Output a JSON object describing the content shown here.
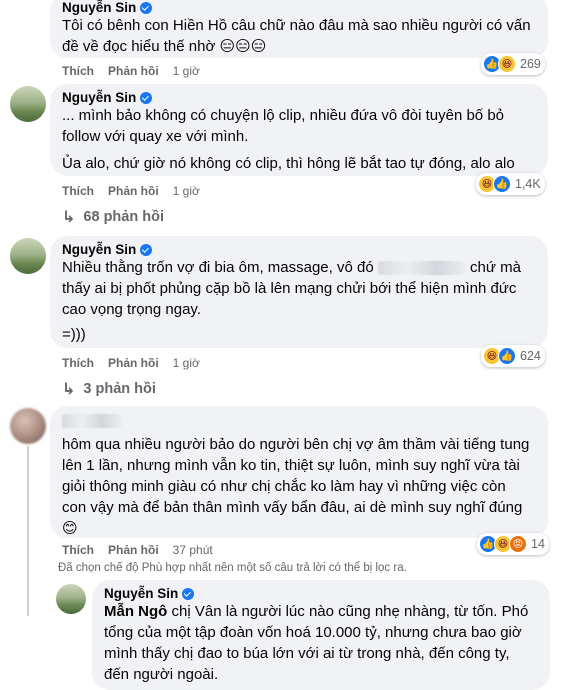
{
  "comments": [
    {
      "author": "Nguyễn Sin",
      "lines": [
        "Tôi có bênh con Hiền Hồ câu chữ nào đâu mà sao nhiều người có vấn",
        "đề về đọc hiểu thế nhờ 😑😑😑"
      ],
      "like_label": "Thích",
      "reply_label": "Phản hồi",
      "time": "1 giờ",
      "reaction_count": "269"
    },
    {
      "author": "Nguyễn Sin",
      "lines": [
        "... mình bảo không có chuyện lộ clip, nhiều đứa vô đòi tuyên bố bỏ",
        "follow với quay xe với mình.",
        "Ủa alo, chứ giờ nó không có clip, thì hông lẽ bắt tao tự đóng, alo alo"
      ],
      "like_label": "Thích",
      "reply_label": "Phản hồi",
      "time": "1 giờ",
      "reaction_count": "1,4K",
      "replies": "68 phản hồi"
    },
    {
      "author": "Nguyễn Sin",
      "lines": [
        "Nhiều thằng trốn vợ đi bia ôm, massage, vô đó",
        "chứ mà",
        "thấy ai bị phốt phủng cặp bồ là lên mạng chửi bới thể hiện mình đức",
        "cao vọng trọng ngay.",
        "=)))"
      ],
      "like_label": "Thích",
      "reply_label": "Phản hồi",
      "time": "1 giờ",
      "reaction_count": "624",
      "replies": "3 phản hồi"
    },
    {
      "author": "",
      "lines": [
        "hôm qua nhiều người bảo do người bên chị vợ âm thầm vài tiếng tung",
        "lên 1 lần, nhưng mình vẫn ko tin, thiệt sự luôn, mình suy nghĩ vừa tài",
        "giỏi thông minh giàu có như chị chắc ko làm hay vì những việc còn",
        "con vậy mà để bản thân mình vấy bẩn đâu, ai dè mình suy nghĩ đúng",
        "😊"
      ],
      "like_label": "Thích",
      "reply_label": "Phản hồi",
      "time": "37 phút",
      "reaction_count": "14"
    }
  ],
  "filter_note": "Đã chọn chế độ Phù hợp nhất nên một số câu trả lời có thể bị lọc ra.",
  "reply": {
    "author": "Nguyễn Sin",
    "mention": "Mẫn Ngô",
    "lines": [
      "chị Vân là người lúc nào cũng nhẹ nhàng, từ tốn. Phó",
      "tổng của một tập đoàn vốn hoá 10.000 tỷ, nhưng chưa bao giờ",
      "mình thấy chị đao to búa lớn với ai từ trong nhà, đến công ty,",
      "đến người ngoài."
    ]
  }
}
